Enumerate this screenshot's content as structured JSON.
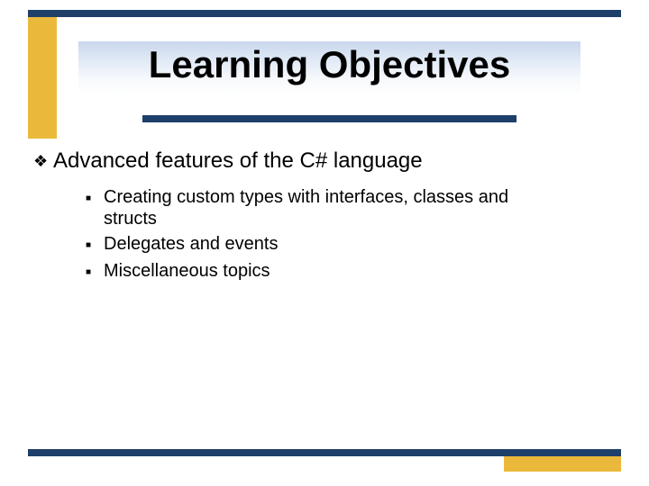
{
  "title": "Learning Objectives",
  "body": {
    "heading": "Advanced features of the C# language",
    "items": [
      "Creating custom types with interfaces, classes and structs",
      "Delegates and events",
      "Miscellaneous topics"
    ]
  },
  "colors": {
    "navy": "#1f3f6b",
    "gold": "#eab93b"
  }
}
